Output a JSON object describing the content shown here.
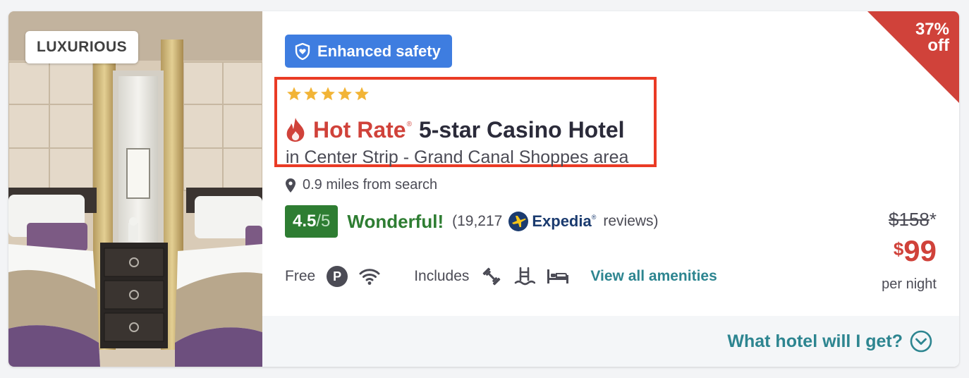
{
  "badge": {
    "label": "LUXURIOUS"
  },
  "safety": {
    "label": "Enhanced safety",
    "icon": "shield-heart-icon"
  },
  "hotel": {
    "stars": 5,
    "deal_label": "Hot Rate",
    "deal_mark": "®",
    "name": "5-star Casino Hotel",
    "area": "in Center Strip - Grand Canal Shoppes area",
    "distance": "0.9 miles from search"
  },
  "rating": {
    "score": "4.5",
    "out_of": "/5",
    "label": "Wonderful!",
    "reviews_prefix": "(19,217",
    "source": "Expedia",
    "source_mark": "®",
    "reviews_suffix": "reviews)"
  },
  "amenities": {
    "free_label": "Free",
    "free_icons": [
      "parking-icon",
      "wifi-icon"
    ],
    "parking_letter": "P",
    "includes_label": "Includes",
    "include_icons": [
      "fitness-icon",
      "pool-icon",
      "bed-icon"
    ],
    "view_all": "View all amenities"
  },
  "price": {
    "discount_pct": "37%",
    "discount_word": "off",
    "old_price": "$158",
    "old_price_note": "*",
    "currency": "$",
    "amount": "99",
    "per_night": "per night"
  },
  "footer": {
    "question": "What hotel will I get?",
    "icon": "chevron-down-circle-icon"
  },
  "colors": {
    "accent_teal": "#2d8590",
    "hot_red": "#d0423a",
    "rating_green": "#2e7d32",
    "safety_blue": "#3e7de0",
    "highlight_border": "#ea3b25",
    "star_gold": "#f2b436"
  }
}
